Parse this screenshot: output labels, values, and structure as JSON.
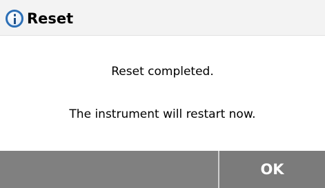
{
  "dialog": {
    "title": "Reset",
    "icon": "info-icon",
    "message_line_1": "Reset completed.",
    "message_line_2": "The instrument will restart now.",
    "ok_label": "OK"
  },
  "colors": {
    "title_bar_bg": "#f3f3f3",
    "icon_blue": "#2c6fb6",
    "button_bar_bg": "#7d7d7d",
    "button_text": "#ffffff"
  }
}
